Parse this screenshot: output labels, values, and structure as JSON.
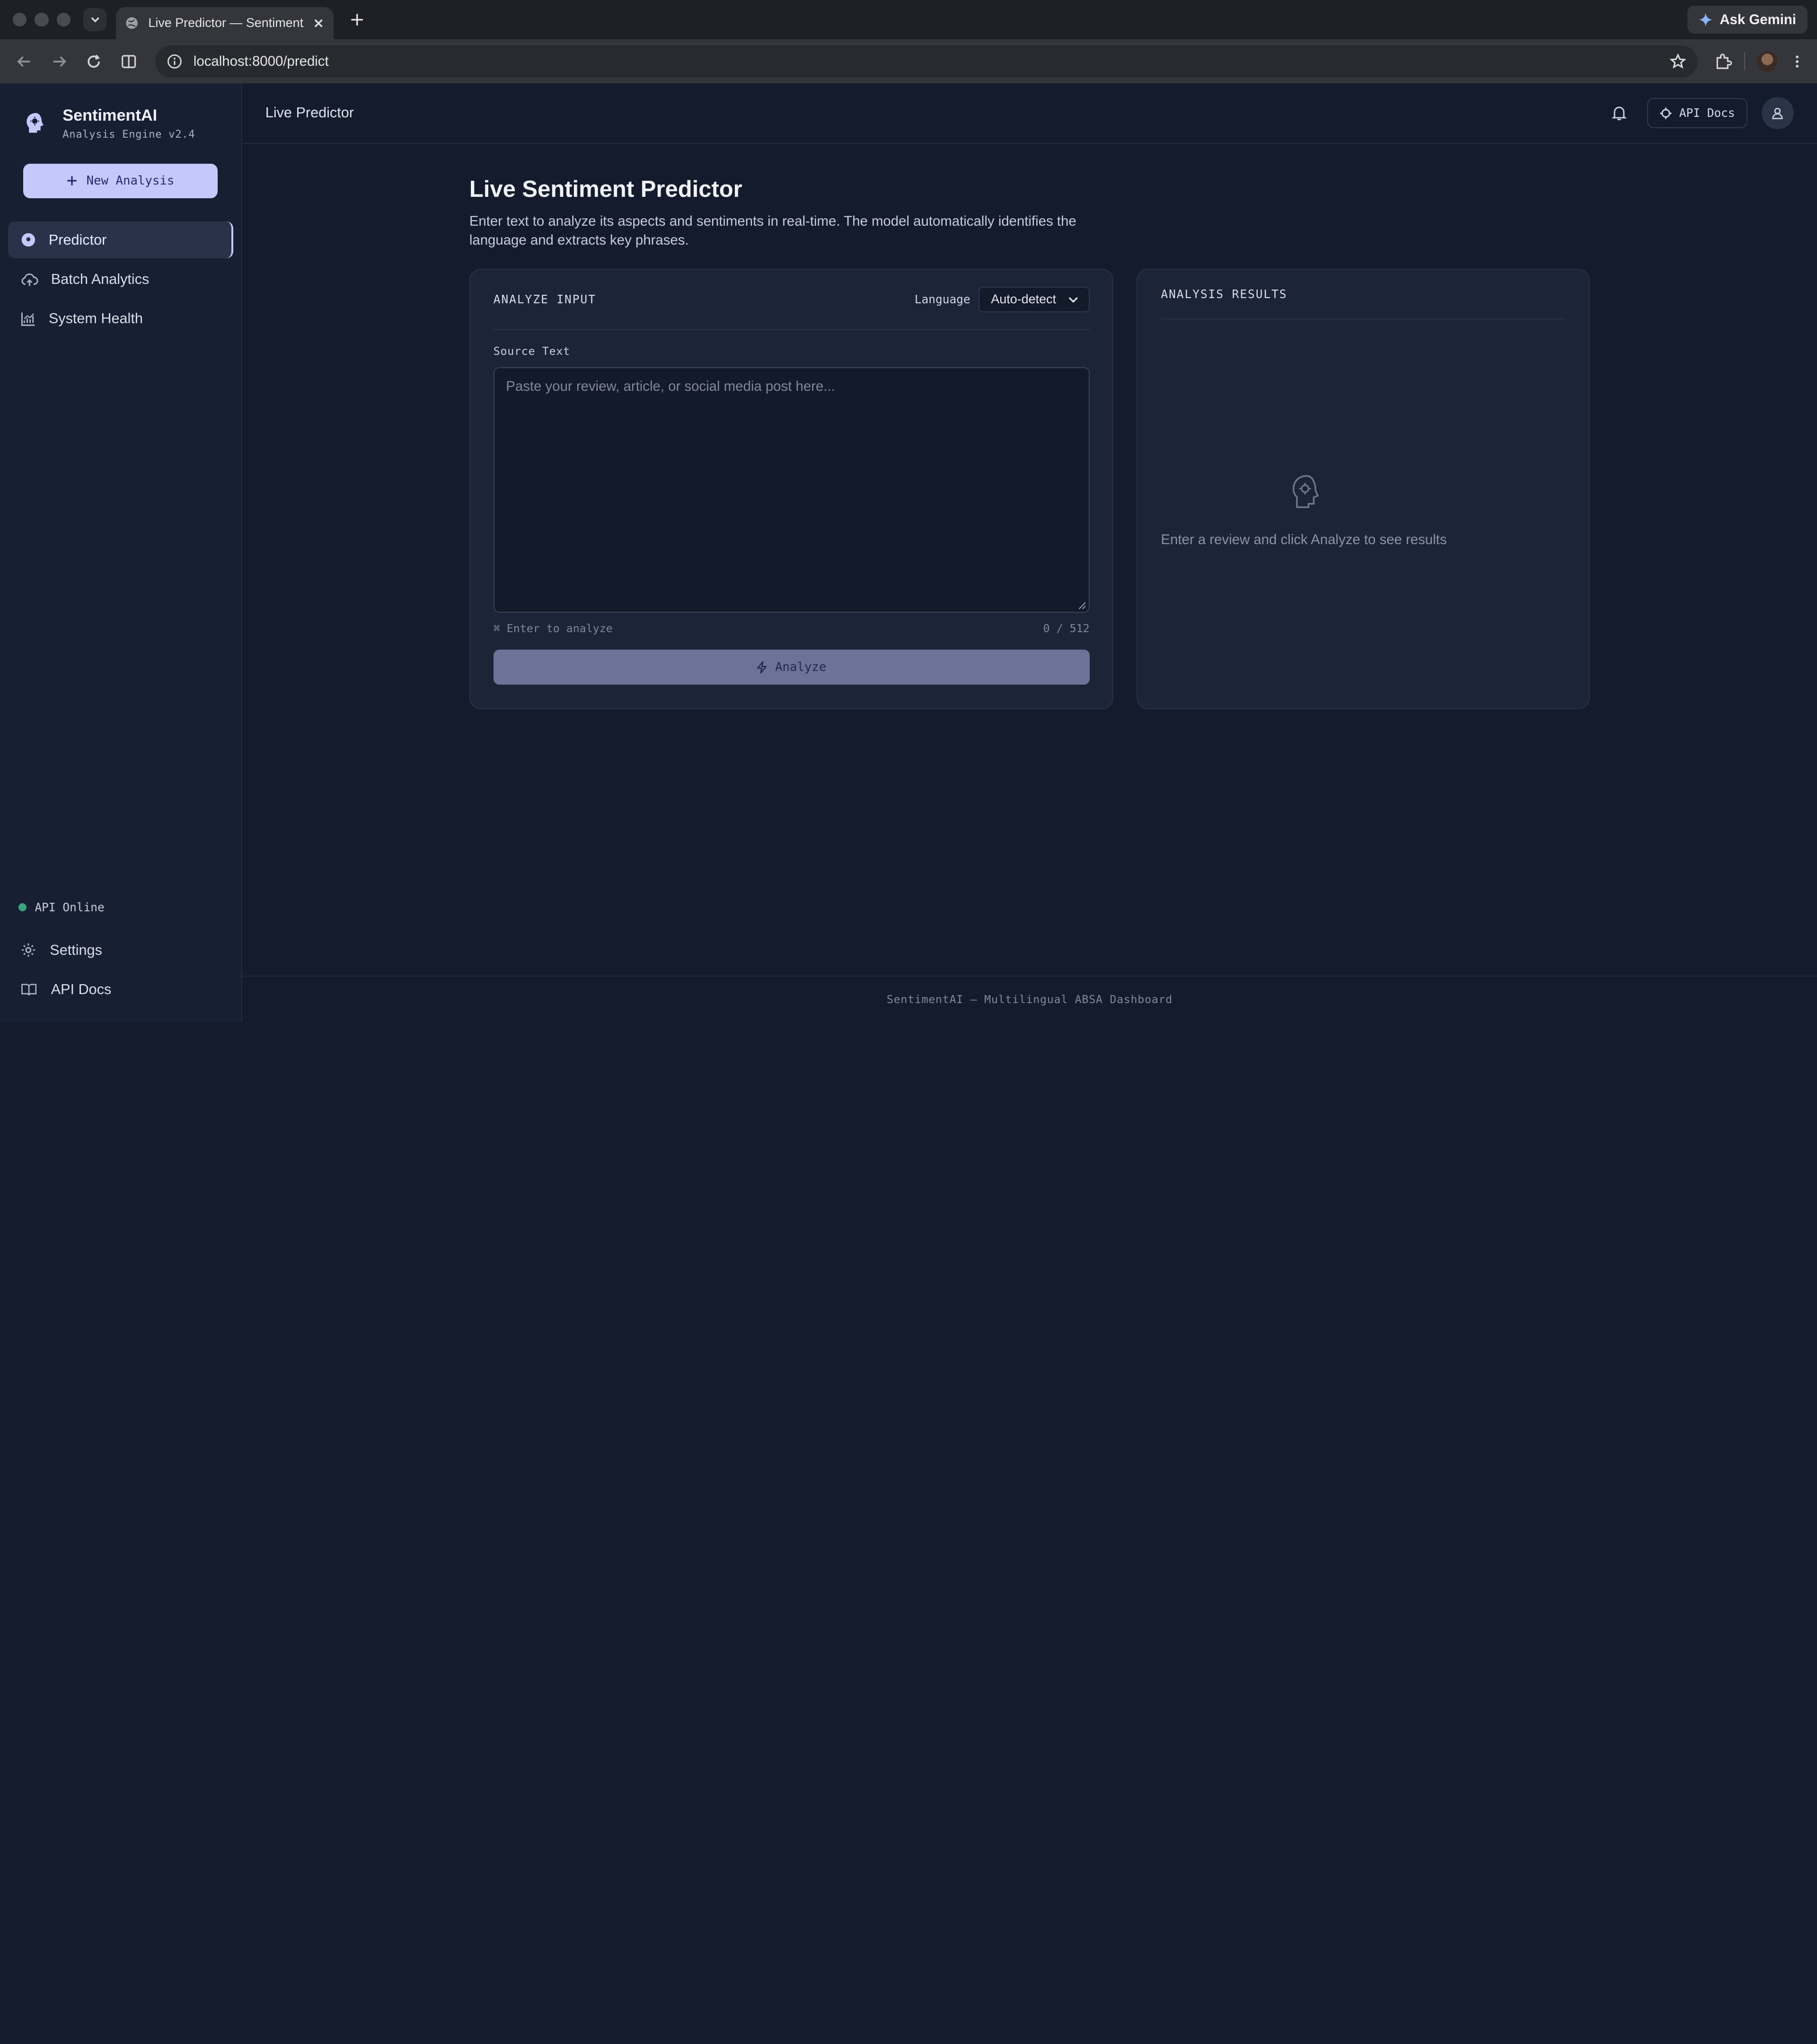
{
  "browser": {
    "tab_title": "Live Predictor — SentimentAI",
    "url": "localhost:8000/predict",
    "gemini_label": "Ask Gemini"
  },
  "sidebar": {
    "brand_name": "SentimentAI",
    "brand_sub": "Analysis Engine v2.4",
    "new_button": "New Analysis",
    "items": [
      {
        "label": "Predictor",
        "icon": "brain-icon",
        "active": true
      },
      {
        "label": "Batch Analytics",
        "icon": "cloud-upload-icon",
        "active": false
      },
      {
        "label": "System Health",
        "icon": "chart-icon",
        "active": false
      }
    ],
    "status": "API Online",
    "bottom_links": [
      {
        "label": "Settings",
        "icon": "gear-icon"
      },
      {
        "label": "API Docs",
        "icon": "book-icon"
      }
    ]
  },
  "topbar": {
    "title": "Live Predictor",
    "api_docs": "API Docs"
  },
  "page": {
    "title": "Live Sentiment Predictor",
    "description": "Enter text to analyze its aspects and sentiments in real-time. The model automatically identifies the language and extracts key phrases."
  },
  "input_panel": {
    "heading": "ANALYZE INPUT",
    "language_label": "Language",
    "language_value": "Auto-detect",
    "source_label": "Source Text",
    "placeholder": "Paste your review, article, or social media post here...",
    "shortcut_hint": "⌘ Enter to analyze",
    "char_count": "0 / 512",
    "analyze_button": "Analyze"
  },
  "results_panel": {
    "heading": "ANALYSIS RESULTS",
    "empty_text": "Enter a review and click Analyze to see results"
  },
  "footer": {
    "text": "SentimentAI — Multilingual ABSA Dashboard"
  },
  "colors": {
    "accent": "#c4c8fb",
    "status_online": "#37a67c",
    "background": "#131b2c"
  }
}
